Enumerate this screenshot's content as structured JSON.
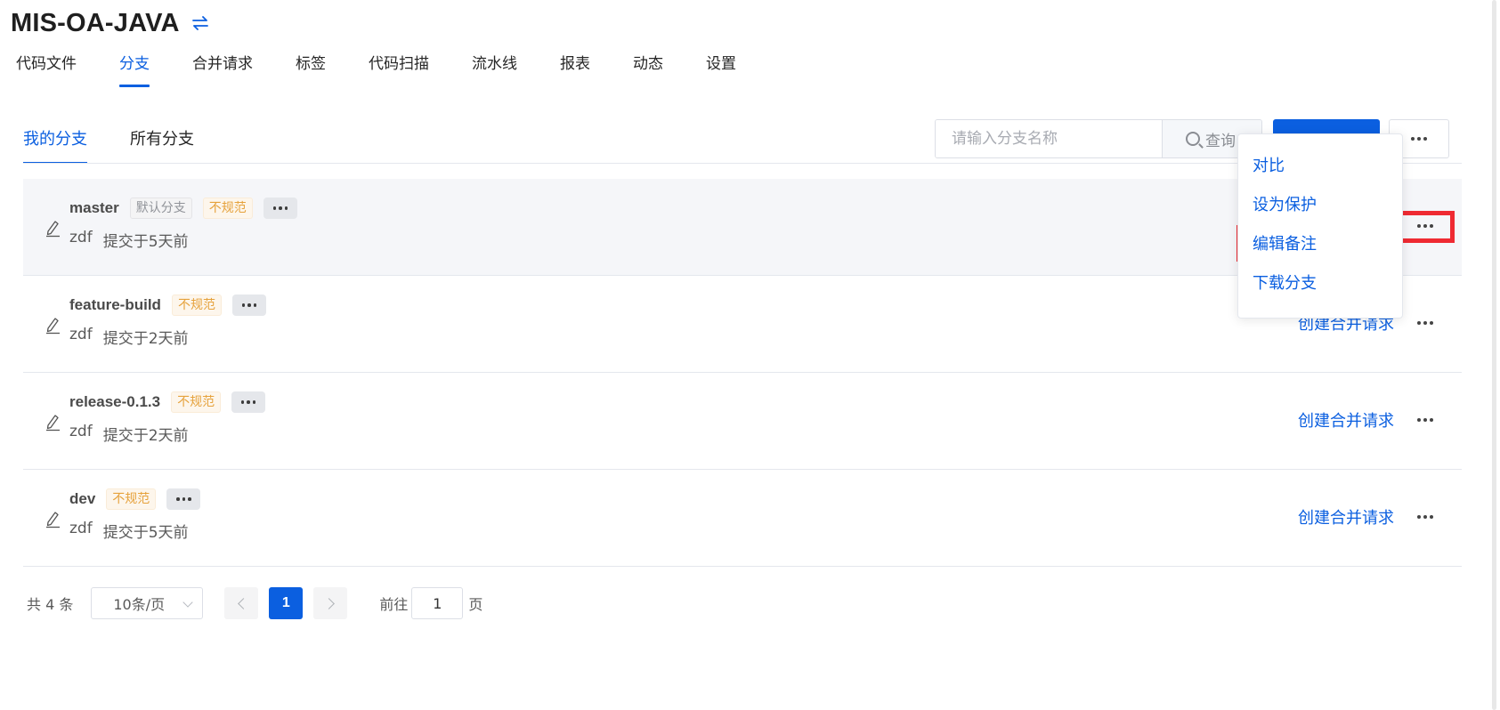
{
  "project": {
    "title": "MIS-OA-JAVA",
    "switch_icon": "switch-arrows-icon"
  },
  "main_tabs": [
    {
      "label": "代码文件"
    },
    {
      "label": "分支",
      "active": true
    },
    {
      "label": "合并请求"
    },
    {
      "label": "标签"
    },
    {
      "label": "代码扫描"
    },
    {
      "label": "流水线"
    },
    {
      "label": "报表"
    },
    {
      "label": "动态"
    },
    {
      "label": "设置"
    }
  ],
  "sub_tabs": [
    {
      "label": "我的分支",
      "active": true
    },
    {
      "label": "所有分支"
    }
  ],
  "search": {
    "placeholder": "请输入分支名称",
    "button_label": "查询"
  },
  "branches": [
    {
      "name": "master",
      "tags": [
        "默认分支",
        "不规范"
      ],
      "author": "zdf",
      "commit_text": "提交于5天前",
      "action_label": "",
      "highlighted": true
    },
    {
      "name": "feature-build",
      "tags": [
        "不规范"
      ],
      "author": "zdf",
      "commit_text": "提交于2天前",
      "action_label": "创建合并请求"
    },
    {
      "name": "release-0.1.3",
      "tags": [
        "不规范"
      ],
      "author": "zdf",
      "commit_text": "提交于2天前",
      "action_label": "创建合并请求"
    },
    {
      "name": "dev",
      "tags": [
        "不规范"
      ],
      "author": "zdf",
      "commit_text": "提交于5天前",
      "action_label": "创建合并请求"
    }
  ],
  "dropdown": {
    "items": [
      {
        "label": "对比"
      },
      {
        "label": "设为保护"
      },
      {
        "label": "编辑备注",
        "highlighted": true
      },
      {
        "label": "下载分支"
      }
    ]
  },
  "pagination": {
    "total": "共 4 条",
    "page_size": "10条/页",
    "current_page": "1",
    "goto_label": "前往",
    "goto_value": "1",
    "goto_suffix": "页"
  },
  "colors": {
    "primary": "#0b5fe0",
    "warning": "#e6a23c",
    "annotation": "#ef2a32"
  }
}
